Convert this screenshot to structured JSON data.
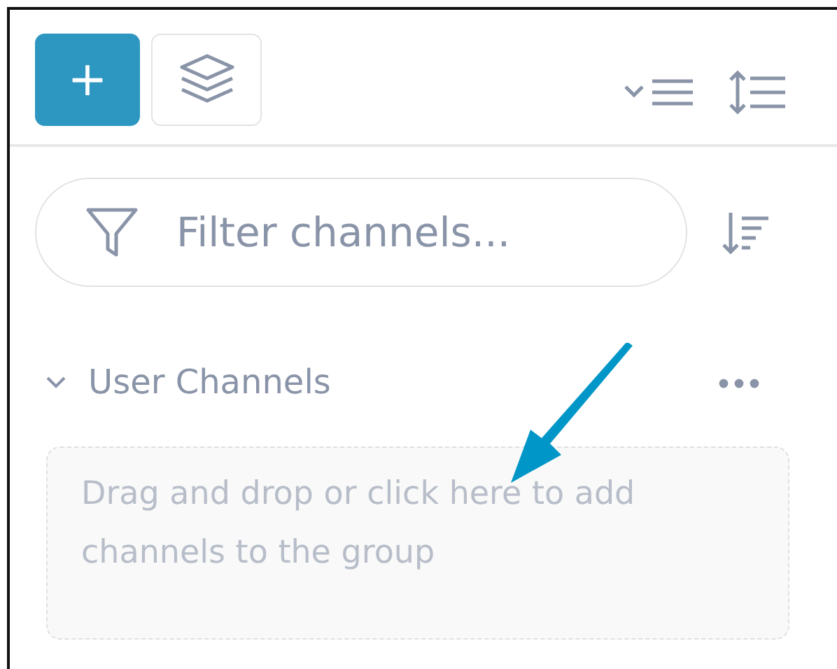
{
  "toolbar": {
    "add_button": {
      "label": "+"
    }
  },
  "filter": {
    "placeholder": "Filter channels..."
  },
  "groups": [
    {
      "title": "User Channels",
      "expanded": true,
      "dropzone": "Drag and drop or click here to add channels to the group"
    }
  ]
}
